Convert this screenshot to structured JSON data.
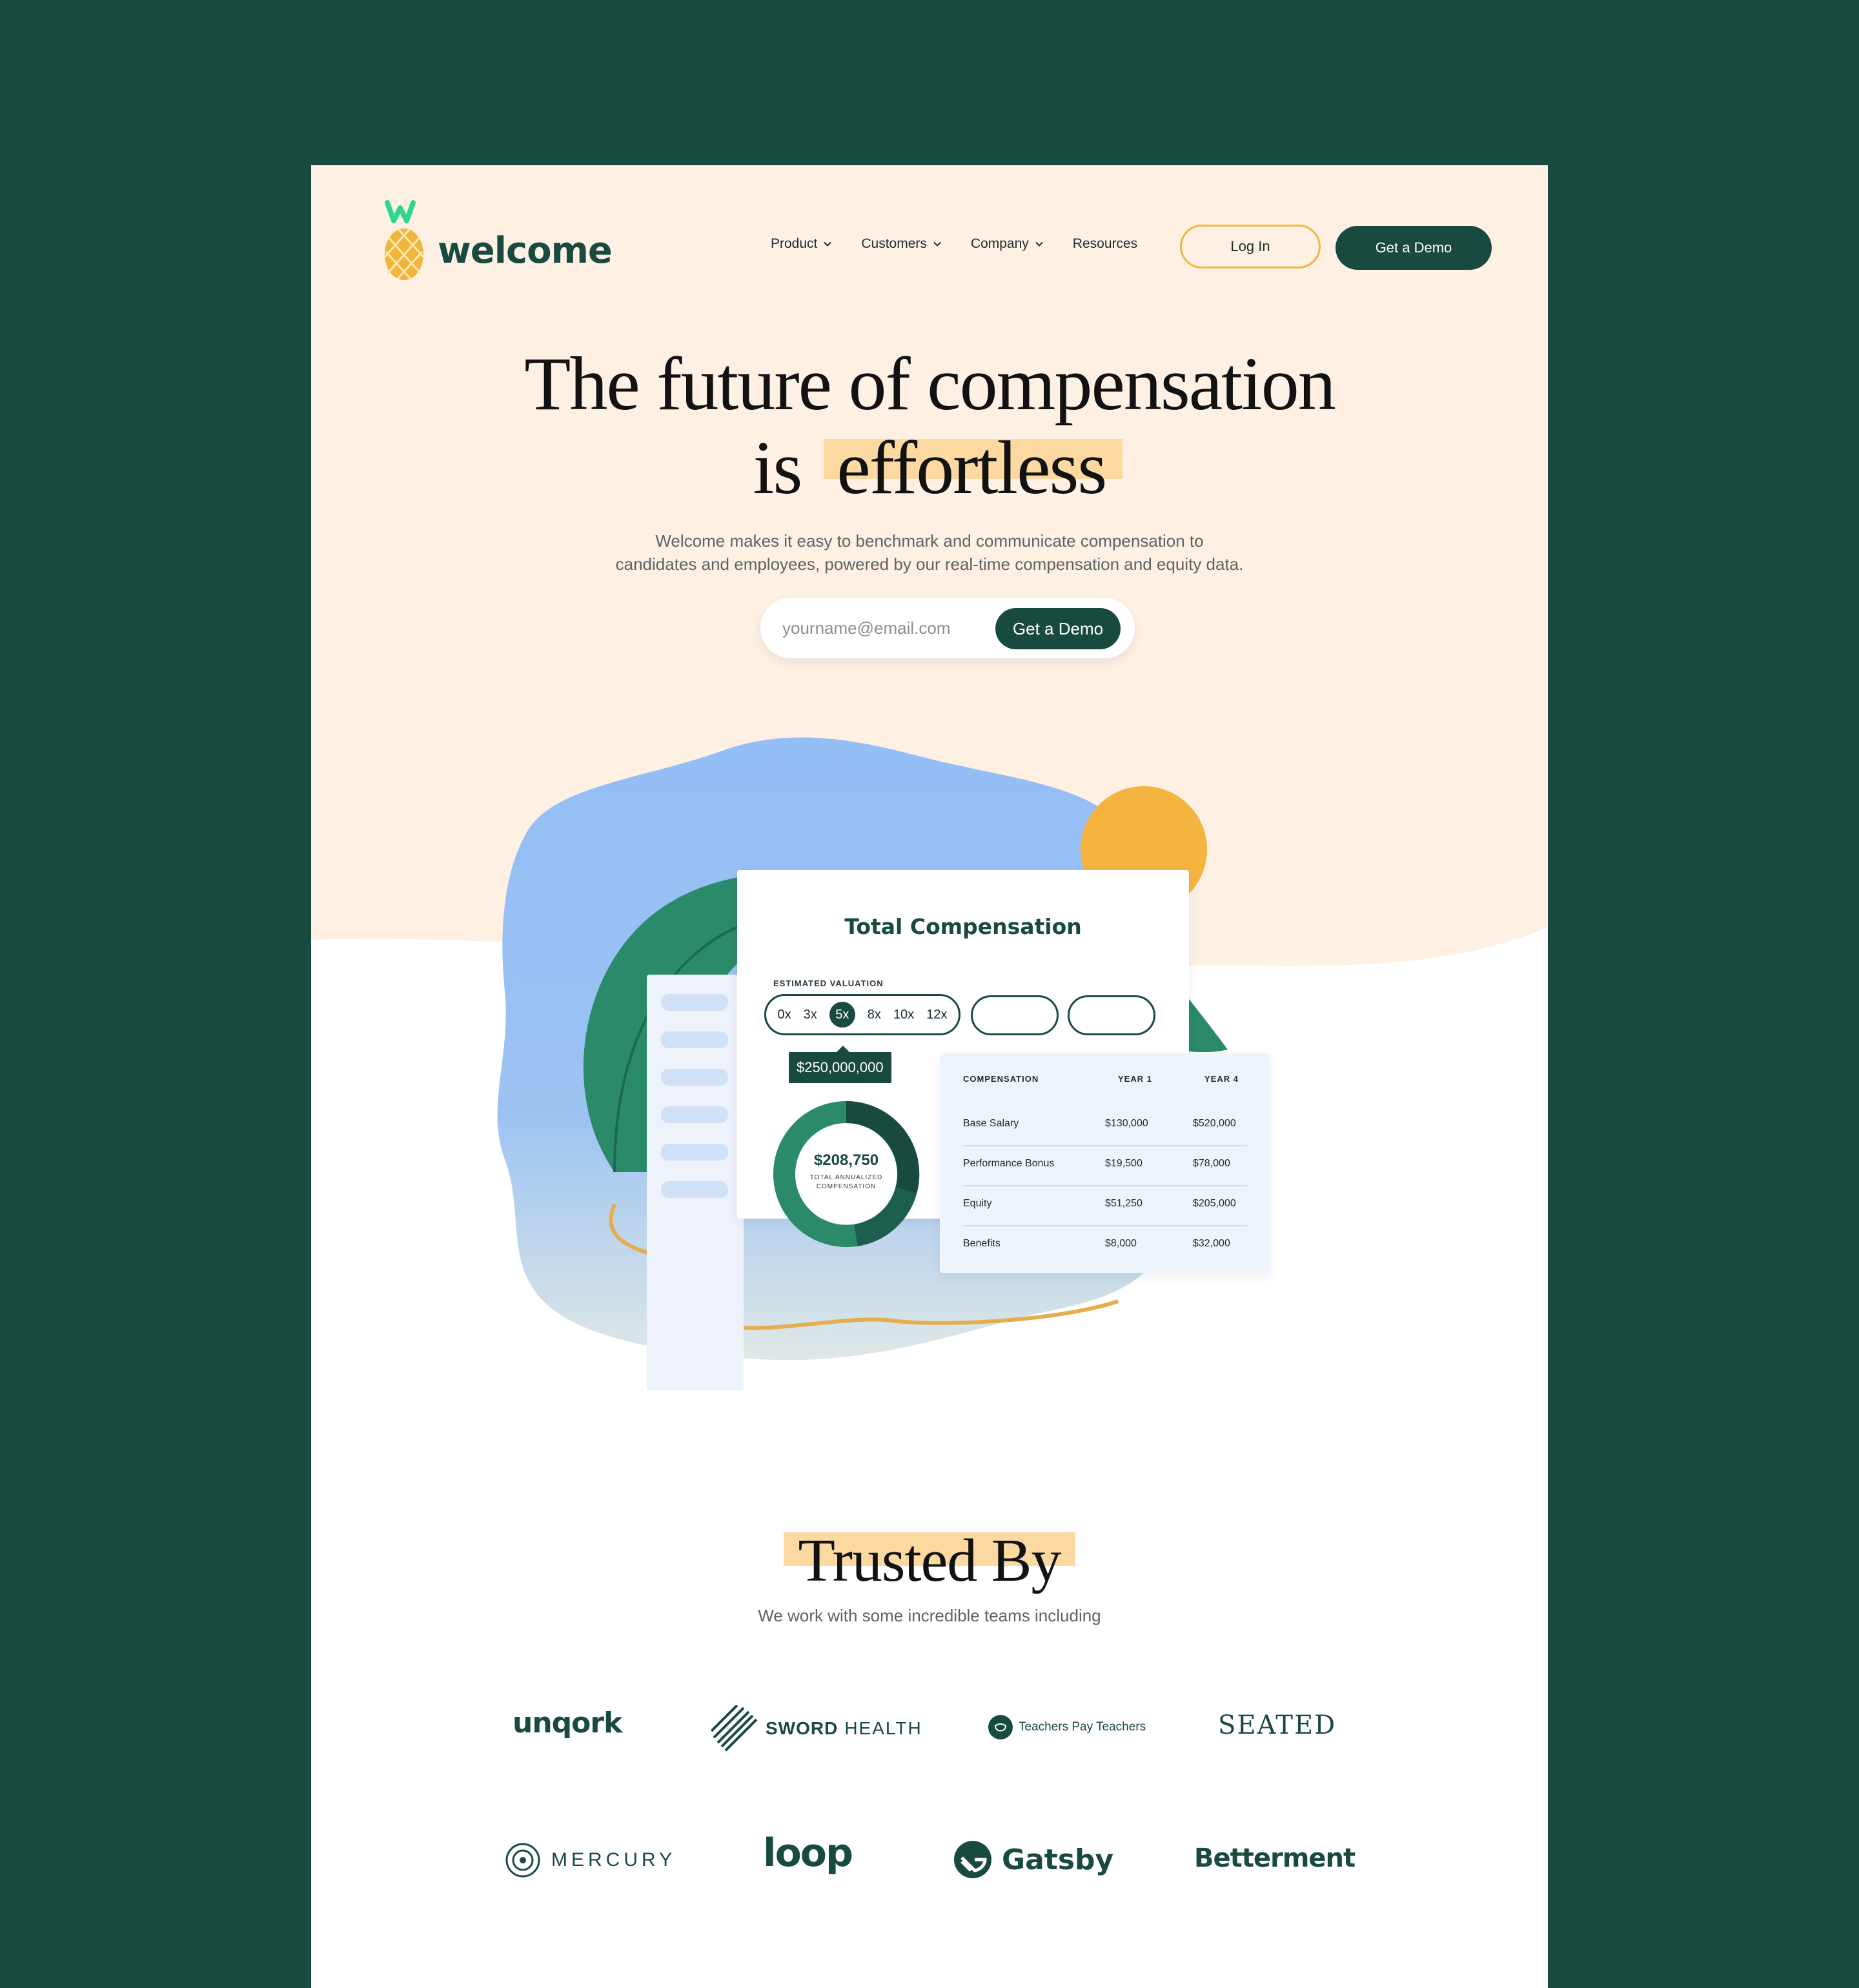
{
  "brand": {
    "name": "welcome",
    "monogram": "w",
    "color": "#184a3f",
    "accent": "#f2b53c"
  },
  "nav": {
    "items": [
      {
        "label": "Product",
        "dropdown": true
      },
      {
        "label": "Customers",
        "dropdown": true
      },
      {
        "label": "Company",
        "dropdown": true
      },
      {
        "label": "Resources",
        "dropdown": false
      }
    ],
    "login_label": "Log In",
    "demo_label": "Get a Demo"
  },
  "hero": {
    "title_line1": "The future of compensation",
    "title_line2_prefix": "is",
    "title_line2_highlight": "effortless",
    "subtitle_line1": "Welcome makes it easy to benchmark and communicate compensation to",
    "subtitle_line2": "candidates and employees, powered by our real-time compensation and equity data.",
    "email_placeholder": "yourname@email.com",
    "cta_label": "Get a Demo"
  },
  "illustration": {
    "card_title": "Total Compensation",
    "valuation_label": "ESTIMATED VALUATION",
    "multipliers": [
      "0x",
      "3x",
      "5x",
      "8x",
      "10x",
      "12x"
    ],
    "selected_multiplier": "5x",
    "valuation_value": "$250,000,000",
    "total_value": "$208,750",
    "total_caption_line1": "TOTAL ANNUALIZED",
    "total_caption_line2": "COMPENSATION",
    "table": {
      "headers": [
        "COMPENSATION",
        "YEAR 1",
        "YEAR 4"
      ],
      "rows": [
        {
          "label": "Base Salary",
          "y1": "$130,000",
          "y4": "$520,000"
        },
        {
          "label": "Performance Bonus",
          "y1": "$19,500",
          "y4": "$78,000"
        },
        {
          "label": "Equity",
          "y1": "$51,250",
          "y4": "$205,000"
        },
        {
          "label": "Benefits",
          "y1": "$8,000",
          "y4": "$32,000"
        }
      ]
    }
  },
  "trusted": {
    "title": "Trusted By",
    "subtitle": "We work with some incredible teams including",
    "logos": {
      "unqork": "unqork",
      "sword_bold": "SWORD",
      "sword_light": "HEALTH",
      "tpt": "Teachers Pay Teachers",
      "seated": "SEATED",
      "mercury": "MERCURY",
      "loop": "loop",
      "gatsby": "Gatsby",
      "betterment": "Betterment"
    }
  }
}
